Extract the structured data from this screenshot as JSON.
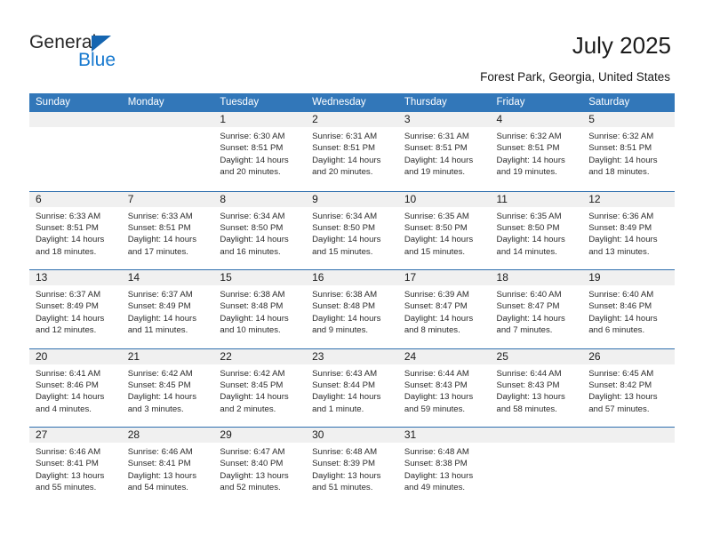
{
  "brand": {
    "name_top": "General",
    "name_bottom": "Blue",
    "triangle_color": "#1565b0",
    "blue_text_color": "#1779cf"
  },
  "header": {
    "title": "July 2025",
    "subtitle": "Forest Park, Georgia, United States",
    "accent_color": "#3277b9",
    "band_color": "#f0f0f0"
  },
  "weekday_headers": [
    "Sunday",
    "Monday",
    "Tuesday",
    "Wednesday",
    "Thursday",
    "Friday",
    "Saturday"
  ],
  "labels": {
    "sunrise_prefix": "Sunrise:",
    "sunset_prefix": "Sunset:",
    "daylight_prefix": "Daylight:"
  },
  "weeks": [
    [
      {
        "day": "",
        "blank": true,
        "sunrise": "",
        "sunset": "",
        "daylight_line1": "",
        "daylight_line2": ""
      },
      {
        "day": "",
        "blank": true,
        "sunrise": "",
        "sunset": "",
        "daylight_line1": "",
        "daylight_line2": ""
      },
      {
        "day": "1",
        "sunrise": "Sunrise: 6:30 AM",
        "sunset": "Sunset: 8:51 PM",
        "daylight_line1": "Daylight: 14 hours",
        "daylight_line2": "and 20 minutes."
      },
      {
        "day": "2",
        "sunrise": "Sunrise: 6:31 AM",
        "sunset": "Sunset: 8:51 PM",
        "daylight_line1": "Daylight: 14 hours",
        "daylight_line2": "and 20 minutes."
      },
      {
        "day": "3",
        "sunrise": "Sunrise: 6:31 AM",
        "sunset": "Sunset: 8:51 PM",
        "daylight_line1": "Daylight: 14 hours",
        "daylight_line2": "and 19 minutes."
      },
      {
        "day": "4",
        "sunrise": "Sunrise: 6:32 AM",
        "sunset": "Sunset: 8:51 PM",
        "daylight_line1": "Daylight: 14 hours",
        "daylight_line2": "and 19 minutes."
      },
      {
        "day": "5",
        "sunrise": "Sunrise: 6:32 AM",
        "sunset": "Sunset: 8:51 PM",
        "daylight_line1": "Daylight: 14 hours",
        "daylight_line2": "and 18 minutes."
      }
    ],
    [
      {
        "day": "6",
        "sunrise": "Sunrise: 6:33 AM",
        "sunset": "Sunset: 8:51 PM",
        "daylight_line1": "Daylight: 14 hours",
        "daylight_line2": "and 18 minutes."
      },
      {
        "day": "7",
        "sunrise": "Sunrise: 6:33 AM",
        "sunset": "Sunset: 8:51 PM",
        "daylight_line1": "Daylight: 14 hours",
        "daylight_line2": "and 17 minutes."
      },
      {
        "day": "8",
        "sunrise": "Sunrise: 6:34 AM",
        "sunset": "Sunset: 8:50 PM",
        "daylight_line1": "Daylight: 14 hours",
        "daylight_line2": "and 16 minutes."
      },
      {
        "day": "9",
        "sunrise": "Sunrise: 6:34 AM",
        "sunset": "Sunset: 8:50 PM",
        "daylight_line1": "Daylight: 14 hours",
        "daylight_line2": "and 15 minutes."
      },
      {
        "day": "10",
        "sunrise": "Sunrise: 6:35 AM",
        "sunset": "Sunset: 8:50 PM",
        "daylight_line1": "Daylight: 14 hours",
        "daylight_line2": "and 15 minutes."
      },
      {
        "day": "11",
        "sunrise": "Sunrise: 6:35 AM",
        "sunset": "Sunset: 8:50 PM",
        "daylight_line1": "Daylight: 14 hours",
        "daylight_line2": "and 14 minutes."
      },
      {
        "day": "12",
        "sunrise": "Sunrise: 6:36 AM",
        "sunset": "Sunset: 8:49 PM",
        "daylight_line1": "Daylight: 14 hours",
        "daylight_line2": "and 13 minutes."
      }
    ],
    [
      {
        "day": "13",
        "sunrise": "Sunrise: 6:37 AM",
        "sunset": "Sunset: 8:49 PM",
        "daylight_line1": "Daylight: 14 hours",
        "daylight_line2": "and 12 minutes."
      },
      {
        "day": "14",
        "sunrise": "Sunrise: 6:37 AM",
        "sunset": "Sunset: 8:49 PM",
        "daylight_line1": "Daylight: 14 hours",
        "daylight_line2": "and 11 minutes."
      },
      {
        "day": "15",
        "sunrise": "Sunrise: 6:38 AM",
        "sunset": "Sunset: 8:48 PM",
        "daylight_line1": "Daylight: 14 hours",
        "daylight_line2": "and 10 minutes."
      },
      {
        "day": "16",
        "sunrise": "Sunrise: 6:38 AM",
        "sunset": "Sunset: 8:48 PM",
        "daylight_line1": "Daylight: 14 hours",
        "daylight_line2": "and 9 minutes."
      },
      {
        "day": "17",
        "sunrise": "Sunrise: 6:39 AM",
        "sunset": "Sunset: 8:47 PM",
        "daylight_line1": "Daylight: 14 hours",
        "daylight_line2": "and 8 minutes."
      },
      {
        "day": "18",
        "sunrise": "Sunrise: 6:40 AM",
        "sunset": "Sunset: 8:47 PM",
        "daylight_line1": "Daylight: 14 hours",
        "daylight_line2": "and 7 minutes."
      },
      {
        "day": "19",
        "sunrise": "Sunrise: 6:40 AM",
        "sunset": "Sunset: 8:46 PM",
        "daylight_line1": "Daylight: 14 hours",
        "daylight_line2": "and 6 minutes."
      }
    ],
    [
      {
        "day": "20",
        "sunrise": "Sunrise: 6:41 AM",
        "sunset": "Sunset: 8:46 PM",
        "daylight_line1": "Daylight: 14 hours",
        "daylight_line2": "and 4 minutes."
      },
      {
        "day": "21",
        "sunrise": "Sunrise: 6:42 AM",
        "sunset": "Sunset: 8:45 PM",
        "daylight_line1": "Daylight: 14 hours",
        "daylight_line2": "and 3 minutes."
      },
      {
        "day": "22",
        "sunrise": "Sunrise: 6:42 AM",
        "sunset": "Sunset: 8:45 PM",
        "daylight_line1": "Daylight: 14 hours",
        "daylight_line2": "and 2 minutes."
      },
      {
        "day": "23",
        "sunrise": "Sunrise: 6:43 AM",
        "sunset": "Sunset: 8:44 PM",
        "daylight_line1": "Daylight: 14 hours",
        "daylight_line2": "and 1 minute."
      },
      {
        "day": "24",
        "sunrise": "Sunrise: 6:44 AM",
        "sunset": "Sunset: 8:43 PM",
        "daylight_line1": "Daylight: 13 hours",
        "daylight_line2": "and 59 minutes."
      },
      {
        "day": "25",
        "sunrise": "Sunrise: 6:44 AM",
        "sunset": "Sunset: 8:43 PM",
        "daylight_line1": "Daylight: 13 hours",
        "daylight_line2": "and 58 minutes."
      },
      {
        "day": "26",
        "sunrise": "Sunrise: 6:45 AM",
        "sunset": "Sunset: 8:42 PM",
        "daylight_line1": "Daylight: 13 hours",
        "daylight_line2": "and 57 minutes."
      }
    ],
    [
      {
        "day": "27",
        "sunrise": "Sunrise: 6:46 AM",
        "sunset": "Sunset: 8:41 PM",
        "daylight_line1": "Daylight: 13 hours",
        "daylight_line2": "and 55 minutes."
      },
      {
        "day": "28",
        "sunrise": "Sunrise: 6:46 AM",
        "sunset": "Sunset: 8:41 PM",
        "daylight_line1": "Daylight: 13 hours",
        "daylight_line2": "and 54 minutes."
      },
      {
        "day": "29",
        "sunrise": "Sunrise: 6:47 AM",
        "sunset": "Sunset: 8:40 PM",
        "daylight_line1": "Daylight: 13 hours",
        "daylight_line2": "and 52 minutes."
      },
      {
        "day": "30",
        "sunrise": "Sunrise: 6:48 AM",
        "sunset": "Sunset: 8:39 PM",
        "daylight_line1": "Daylight: 13 hours",
        "daylight_line2": "and 51 minutes."
      },
      {
        "day": "31",
        "sunrise": "Sunrise: 6:48 AM",
        "sunset": "Sunset: 8:38 PM",
        "daylight_line1": "Daylight: 13 hours",
        "daylight_line2": "and 49 minutes."
      },
      {
        "day": "",
        "blank": true,
        "sunrise": "",
        "sunset": "",
        "daylight_line1": "",
        "daylight_line2": ""
      },
      {
        "day": "",
        "blank": true,
        "sunrise": "",
        "sunset": "",
        "daylight_line1": "",
        "daylight_line2": ""
      }
    ]
  ]
}
